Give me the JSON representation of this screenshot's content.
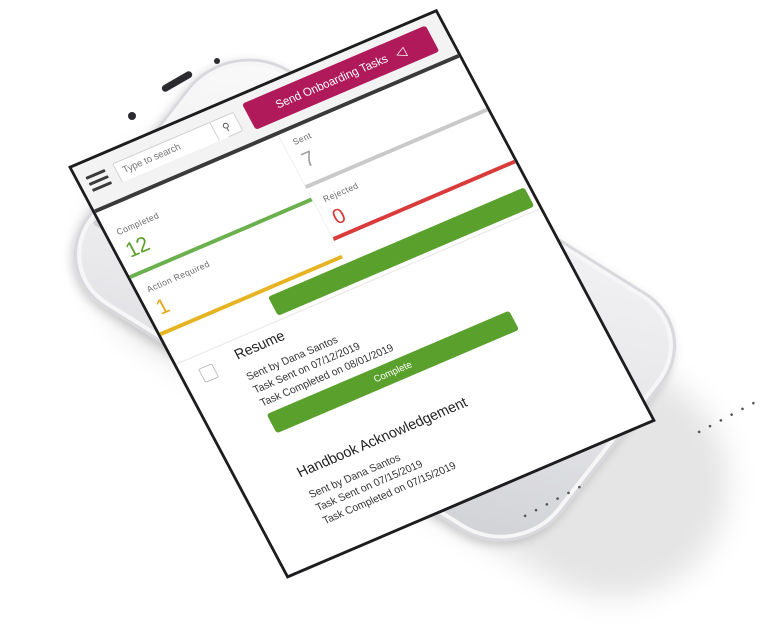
{
  "header": {
    "search_placeholder": "Type to search",
    "search_icon": "search-icon",
    "send_button_label": "Send Onboarding Tasks",
    "send_icon": "send-arrow-icon"
  },
  "stats": {
    "sent": {
      "label": "Sent",
      "value": "7"
    },
    "completed": {
      "label": "Completed",
      "value": "12"
    },
    "rejected": {
      "label": "Rejected",
      "value": "0"
    },
    "action_required": {
      "label": "Action Required",
      "value": "1"
    }
  },
  "tasks": [
    {
      "title": "Resume",
      "sent_by": "Sent by Dana Santos",
      "sent_on": "Task Sent on 07/12/2019",
      "completed_on": "Task Completed on 08/01/2019",
      "button_label": "Complete"
    },
    {
      "title": "Handbook Acknowledgement",
      "sent_by": "Sent by Dana Santos",
      "sent_on": "Task Sent on 07/15/2019",
      "completed_on": "Task Completed on 07/15/2019"
    }
  ],
  "colors": {
    "brand": "#b0195a",
    "completed": "#5aa02c",
    "rejected": "#d93b3b",
    "action_required": "#e6a619",
    "sent": "#a0a0a0"
  }
}
